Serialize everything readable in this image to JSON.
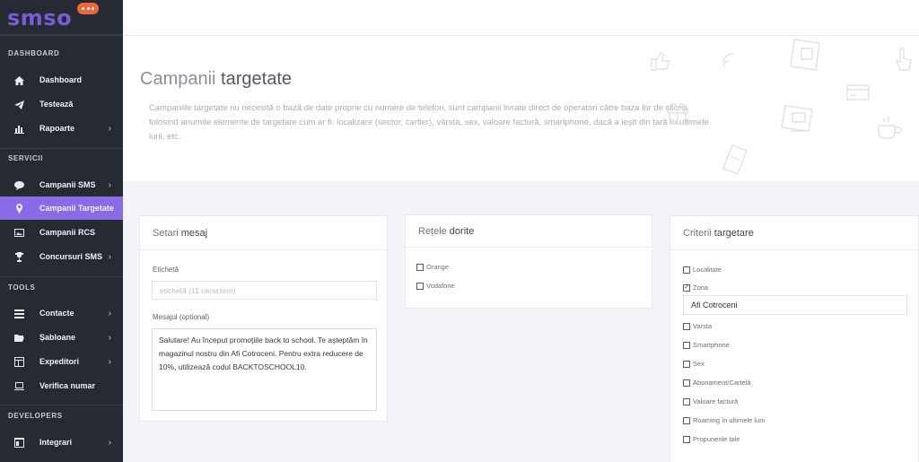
{
  "brand": {
    "logo": "smso",
    "bubble_color": "#f0653b",
    "logo_color": "#7b5cd6"
  },
  "sidebar": {
    "sections": [
      {
        "title": "DASHBOARD"
      },
      {
        "title": "SERVICII"
      },
      {
        "title": "TOOLS"
      },
      {
        "title": "DEVELOPERS"
      }
    ],
    "items": [
      {
        "label": "Dashboard",
        "icon": "home-icon",
        "chevron": false,
        "active": false
      },
      {
        "label": "Testează",
        "icon": "paper-plane-icon",
        "chevron": false,
        "active": false
      },
      {
        "label": "Rapoarte",
        "icon": "bar-chart-icon",
        "chevron": true,
        "active": false
      },
      {
        "label": "Campanii SMS",
        "icon": "speech-bubble-icon",
        "chevron": true,
        "active": false
      },
      {
        "label": "Campanii Targetate",
        "icon": "map-pin-icon",
        "chevron": false,
        "active": true
      },
      {
        "label": "Campanii RCS",
        "icon": "image-icon",
        "chevron": false,
        "active": false
      },
      {
        "label": "Concursuri SMS",
        "icon": "trophy-icon",
        "chevron": true,
        "active": false
      },
      {
        "label": "Contacte",
        "icon": "contacts-list-icon",
        "chevron": true,
        "active": false
      },
      {
        "label": "Șabloane",
        "icon": "folder-open-icon",
        "chevron": true,
        "active": false
      },
      {
        "label": "Expeditori",
        "icon": "layout-icon",
        "chevron": true,
        "active": false
      },
      {
        "label": "Verifica numar",
        "icon": "laptop-icon",
        "chevron": false,
        "active": false
      },
      {
        "label": "Integrari",
        "icon": "window-icon",
        "chevron": true,
        "active": false
      }
    ],
    "chevron_glyph": "›",
    "active_color": "#8a6ae6"
  },
  "hero": {
    "title_light": "Campanii",
    "title_bold": "targetate",
    "description": "Campaniile targetate nu necesită o bază de date proprie cu numere de telefon, sunt campanii livrate direct de operatori către baza lor de clienți folosind anumite elemente de targetare cum ar fi: localizare (sector, cartier), vârsta, sex, valoare factură, smartphone, dacă a ieșit din țară în ultimele luni, etc."
  },
  "setari": {
    "title_light": "Setari",
    "title_bold": "mesaj",
    "eticheta_label": "Etichetă",
    "eticheta_placeholder": "etichetă (11 caractere)",
    "mesaj_label": "Mesajul (optional)",
    "mesaj_value": "Salutare! Au început promoțiile back to school. Te așteptăm în magazinul nostru din Afi Cotroceni. Pentru extra reducere de 10%, utilizează codul BACKTOSCHOOL10."
  },
  "retele": {
    "title_light": "Rețele",
    "title_bold": "dorite",
    "options": [
      {
        "label": "Orange",
        "checked": false
      },
      {
        "label": "Vodafone",
        "checked": false
      }
    ]
  },
  "criterii": {
    "title_light": "Criterii",
    "title_bold": "targetare",
    "options": [
      {
        "label": "Localitate",
        "checked": false
      },
      {
        "label": "Zona",
        "checked": true
      },
      {
        "label": "Varsta",
        "checked": false
      },
      {
        "label": "Smartphone",
        "checked": false
      },
      {
        "label": "Sex",
        "checked": false
      },
      {
        "label": "Abonament/Cartelă",
        "checked": false
      },
      {
        "label": "Valoare factură",
        "checked": false
      },
      {
        "label": "Roaming în ultimele luni",
        "checked": false
      },
      {
        "label": "Propunerile tale",
        "checked": false
      }
    ],
    "zona_value": "Afi Cotroceni"
  }
}
